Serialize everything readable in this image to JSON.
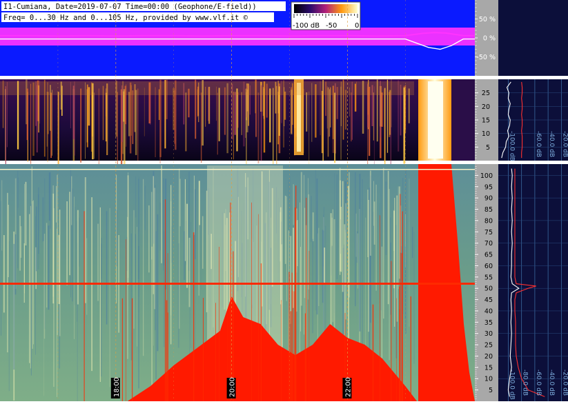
{
  "header": {
    "line1": "I1-Cumiana, Date=2019-07-07 Time=00:00 (Geophone/E-field))",
    "line2": "Freq= 0...30 Hz and 0...105 Hz, provided by www.vlf.it ©"
  },
  "colorbar": {
    "labels": [
      "-100 dB",
      "-50",
      "0"
    ]
  },
  "time_axis": {
    "labels": [
      "18:00",
      "20:00",
      "22:00"
    ]
  },
  "chart_data": [
    {
      "type": "line",
      "panel": "amplitude strip",
      "y_unit": "%",
      "ylim": [
        -100,
        100
      ],
      "y_ticks": [
        "50 %",
        "0 %",
        "-50 %"
      ],
      "series": [
        {
          "color": "#ff33ff",
          "x_hours": [
            16.0,
            16.5,
            17.0,
            17.5,
            18.0,
            18.5,
            19.0,
            19.5,
            20.0,
            20.5,
            21.0,
            21.5,
            22.0,
            22.5,
            23.0,
            23.3,
            23.5,
            23.7,
            24.0,
            24.2
          ],
          "values": [
            6,
            6,
            5,
            6,
            5,
            6,
            6,
            5,
            6,
            6,
            5,
            6,
            6,
            5,
            6,
            12,
            14,
            13,
            6,
            6
          ]
        },
        {
          "color": "#ffffff",
          "x_hours": [
            16.0,
            17.0,
            18.0,
            19.0,
            20.0,
            21.0,
            22.0,
            23.0,
            23.4,
            23.6,
            23.8,
            24.0,
            24.2
          ],
          "values": [
            -3,
            -3,
            -3,
            -3,
            -3,
            -3,
            -3,
            -3,
            -25,
            -30,
            -20,
            -3,
            -3
          ]
        }
      ]
    },
    {
      "type": "heatmap",
      "panel": "spectrogram 0-30 Hz",
      "y_unit": "Hz",
      "ylim": [
        0,
        30
      ],
      "y_ticks": [
        "25",
        "20",
        "15",
        "10",
        "5"
      ],
      "x_range_hours": [
        16.0,
        24.2
      ],
      "colorbar_db": [
        -100,
        0
      ]
    },
    {
      "type": "heatmap",
      "panel": "spectrogram 0-105 Hz",
      "y_unit": "Hz",
      "ylim": [
        0,
        105
      ],
      "y_ticks": [
        "100",
        "95",
        "90",
        "85",
        "80",
        "75",
        "70",
        "65",
        "60",
        "55",
        "50",
        "45",
        "40",
        "35",
        "30",
        "25",
        "20",
        "15",
        "10",
        "5"
      ],
      "x_range_hours": [
        16.0,
        24.2
      ],
      "x_ticks": [
        "18:00",
        "20:00",
        "22:00"
      ],
      "colorbar_db": [
        -100,
        0
      ]
    },
    {
      "type": "line",
      "panel": "spectrum 0-30 Hz",
      "x_unit": "dB",
      "x_ticks": [
        "-100.0 dB",
        "-60.0 dB",
        "-40.0 dB",
        "-20.0 dB"
      ],
      "series": [
        {
          "color": "#ffffff",
          "freq_hz": [
            1,
            3,
            5,
            7,
            9,
            11,
            13,
            15,
            17,
            19,
            21,
            23,
            25,
            27,
            29
          ],
          "db": [
            -110,
            -108,
            -104,
            -103,
            -99,
            -101,
            -98,
            -97,
            -100,
            -99,
            -97,
            -100,
            -99,
            -102,
            -96
          ]
        },
        {
          "color": "#ff3030",
          "freq_hz": [
            1,
            3,
            5,
            7,
            9,
            11,
            13,
            15,
            17,
            19,
            21,
            23,
            25,
            27,
            29
          ],
          "db": [
            -80,
            -80,
            -79,
            -79,
            -79,
            -80,
            -79,
            -79,
            -80,
            -79,
            -79,
            -80,
            -79,
            -79,
            -80
          ]
        }
      ]
    },
    {
      "type": "line",
      "panel": "spectrum 0-105 Hz",
      "x_unit": "dB",
      "x_ticks": [
        "-100.0 dB",
        "-80.0 dB",
        "-60.0 dB",
        "-40.0 dB",
        "-20.0 dB"
      ],
      "series": [
        {
          "color": "#ffffff",
          "freq_hz": [
            2,
            5,
            10,
            15,
            20,
            25,
            30,
            35,
            40,
            45,
            48,
            50,
            52,
            55,
            60,
            65,
            70,
            75,
            80,
            85,
            90,
            95,
            100,
            103
          ],
          "db": [
            -98,
            -100,
            -98,
            -95,
            -97,
            -96,
            -95,
            -96,
            -95,
            -96,
            -95,
            -84,
            -94,
            -96,
            -95,
            -95,
            -94,
            -95,
            -94,
            -95,
            -94,
            -95,
            -94,
            -95
          ]
        },
        {
          "color": "#ff3030",
          "freq_hz": [
            2,
            5,
            10,
            15,
            20,
            25,
            30,
            35,
            40,
            45,
            48,
            50,
            51,
            52,
            55,
            60,
            65,
            70,
            75,
            80,
            85,
            90,
            95,
            100,
            103
          ],
          "db": [
            -45,
            -70,
            -80,
            -85,
            -88,
            -89,
            -89,
            -89,
            -90,
            -90,
            -88,
            -70,
            -58,
            -88,
            -90,
            -90,
            -90,
            -90,
            -90,
            -90,
            -90,
            -90,
            -90,
            -90,
            -90
          ]
        }
      ]
    }
  ]
}
